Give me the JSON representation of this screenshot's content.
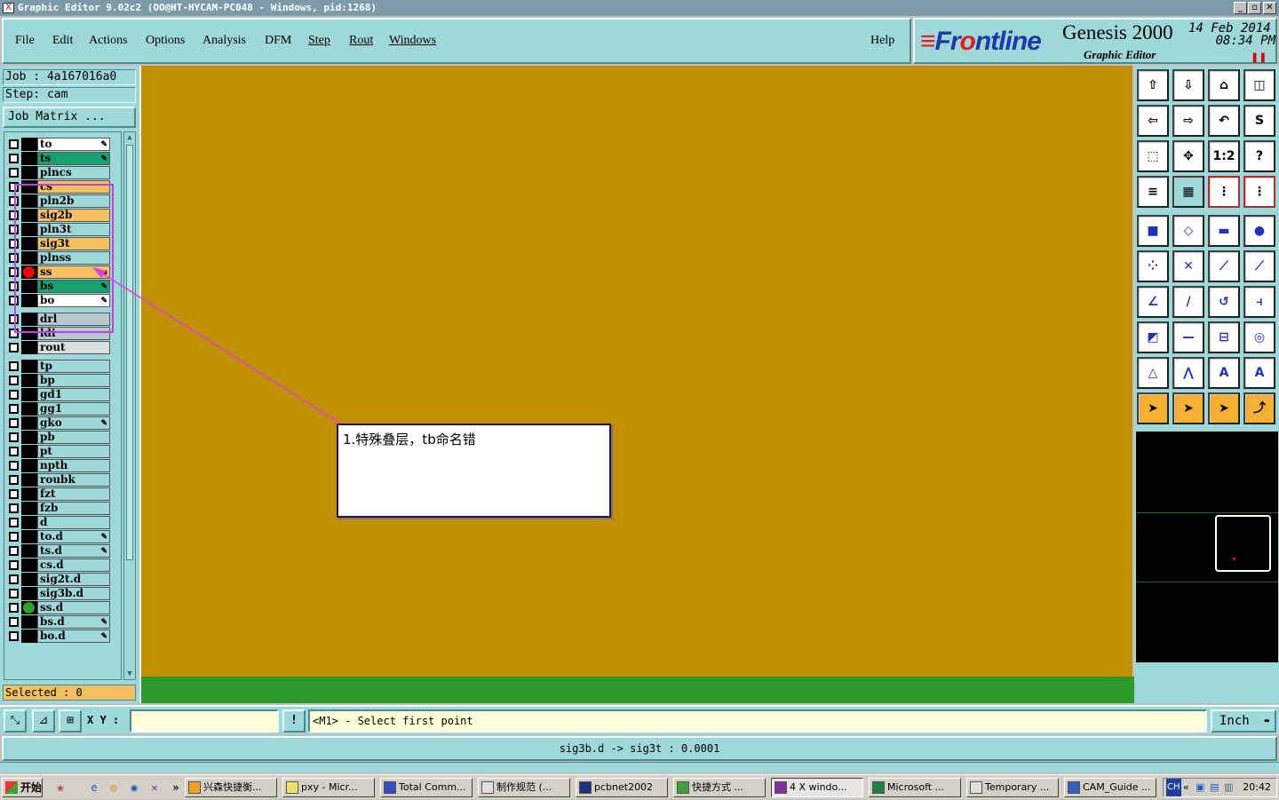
{
  "window": {
    "title": "Graphic Editor 9.02c2 (OO@HT-HYCAM-PC048 - Windows, pid:1268)"
  },
  "menu": {
    "items": [
      "File",
      "Edit",
      "Actions",
      "Options",
      "Analysis",
      "DFM",
      "Step",
      "Rout",
      "Windows"
    ],
    "help": "Help"
  },
  "brand": {
    "logo_a": "Fr",
    "logo_o": "o",
    "logo_b": "ntline",
    "product": "Genesis 2000",
    "subtitle": "Graphic Editor",
    "date": "14 Feb 2014",
    "time": "08:34 PM"
  },
  "job": {
    "job_label": "Job  :  4a167016a0",
    "step_label": "Step:  cam",
    "matrix_button": "Job Matrix ..."
  },
  "layers": [
    {
      "name": "to",
      "color": "#ffffff",
      "mark": "✎"
    },
    {
      "name": "ts",
      "color": "#18a070",
      "mark": "✎"
    },
    {
      "name": "plncs",
      "color": "#9ed8d8",
      "mark": ""
    },
    {
      "name": "cs",
      "color": "#f5c060",
      "mark": ""
    },
    {
      "name": "pln2b",
      "color": "#9ed8d8",
      "mark": ""
    },
    {
      "name": "sig2b",
      "color": "#f5c060",
      "mark": ""
    },
    {
      "name": "pln3t",
      "color": "#9ed8d8",
      "mark": ""
    },
    {
      "name": "sig3t",
      "color": "#f5c060",
      "mark": ""
    },
    {
      "name": "plnss",
      "color": "#9ed8d8",
      "mark": ""
    },
    {
      "name": "ss",
      "color": "#f5c060",
      "mark": "▪",
      "dot": "#ff0000"
    },
    {
      "name": "bs",
      "color": "#18a070",
      "mark": "✎"
    },
    {
      "name": "bo",
      "color": "#ffffff",
      "mark": "✎"
    },
    {
      "name": "drl",
      "color": "#b8c8d0",
      "mark": "",
      "gap": true
    },
    {
      "name": "ldi",
      "color": "#b8c8d0",
      "mark": ""
    },
    {
      "name": "rout",
      "color": "#d8e0e0",
      "mark": ""
    },
    {
      "name": "tp",
      "color": "#9ed8d8",
      "mark": "",
      "gap": true
    },
    {
      "name": "bp",
      "color": "#9ed8d8",
      "mark": ""
    },
    {
      "name": "gd1",
      "color": "#9ed8d8",
      "mark": ""
    },
    {
      "name": "gg1",
      "color": "#9ed8d8",
      "mark": ""
    },
    {
      "name": "gko",
      "color": "#9ed8d8",
      "mark": "✎"
    },
    {
      "name": "pb",
      "color": "#9ed8d8",
      "mark": ""
    },
    {
      "name": "pt",
      "color": "#9ed8d8",
      "mark": ""
    },
    {
      "name": "npth",
      "color": "#9ed8d8",
      "mark": ""
    },
    {
      "name": "roubk",
      "color": "#9ed8d8",
      "mark": ""
    },
    {
      "name": "fzt",
      "color": "#9ed8d8",
      "mark": ""
    },
    {
      "name": "fzb",
      "color": "#9ed8d8",
      "mark": ""
    },
    {
      "name": "d",
      "color": "#9ed8d8",
      "mark": ""
    },
    {
      "name": "to.d",
      "color": "#9ed8d8",
      "mark": "✎"
    },
    {
      "name": "ts.d",
      "color": "#9ed8d8",
      "mark": "✎"
    },
    {
      "name": "cs.d",
      "color": "#9ed8d8",
      "mark": ""
    },
    {
      "name": "sig2t.d",
      "color": "#9ed8d8",
      "mark": ""
    },
    {
      "name": "sig3b.d",
      "color": "#9ed8d8",
      "mark": ""
    },
    {
      "name": "ss.d",
      "color": "#9ed8d8",
      "mark": "",
      "dot": "#30a020"
    },
    {
      "name": "bs.d",
      "color": "#9ed8d8",
      "mark": "✎"
    },
    {
      "name": "bo.d",
      "color": "#9ed8d8",
      "mark": "✎"
    }
  ],
  "selected": "Selected : 0",
  "callout": {
    "text": "1.特殊叠层，tb命名错"
  },
  "tools": [
    [
      "⇧",
      "⇩",
      "⌂",
      "◫"
    ],
    [
      "⇦",
      "⇨",
      "↶",
      "S"
    ],
    [
      "⬚",
      "✥",
      "1:2",
      "?"
    ],
    [
      "≡",
      "▦",
      "⋮",
      "⋮"
    ],
    [
      "■",
      "◇",
      "▬",
      "●"
    ],
    [
      "⁘",
      "✕",
      "⟋",
      "⟋"
    ],
    [
      "∠",
      "/",
      "↺",
      "⫞"
    ],
    [
      "◩",
      "—",
      "⊟",
      "◎"
    ],
    [
      "△",
      "⋀",
      "A",
      "A"
    ],
    [
      "➤",
      "➤",
      "➤",
      "⤴"
    ]
  ],
  "command": {
    "xy_label": "X Y :",
    "xy_value": "",
    "prompt": "<M1> - Select first point",
    "units": "Inch",
    "units_arrow": "▬"
  },
  "status": "sig3b.d -> sig3t : 0.0001",
  "taskbar": {
    "start": "开始",
    "tasks": [
      {
        "label": "兴森快捷衡...",
        "w": 104,
        "ic": "#f0a020"
      },
      {
        "label": "pxy - Micr...",
        "w": 104,
        "ic": "#f0e060"
      },
      {
        "label": "Total Comm...",
        "w": 104,
        "ic": "#3050c0"
      },
      {
        "label": "制作规范 (...",
        "w": 104,
        "ic": "#e0e0e0"
      },
      {
        "label": "pcbnet2002",
        "w": 104,
        "ic": "#203080"
      },
      {
        "label": "快捷方式 ...",
        "w": 104,
        "ic": "#40a040"
      },
      {
        "label": "4 X windo...",
        "w": 104,
        "ic": "#8030a0",
        "active": true
      },
      {
        "label": "Microsoft ...",
        "w": 104,
        "ic": "#208040"
      },
      {
        "label": "Temporary ...",
        "w": 104,
        "ic": "#e0e0e0"
      },
      {
        "label": "CAM_Guide ...",
        "w": 104,
        "ic": "#3060c0"
      }
    ],
    "tray_lang": "CH",
    "clock": "20:42"
  }
}
